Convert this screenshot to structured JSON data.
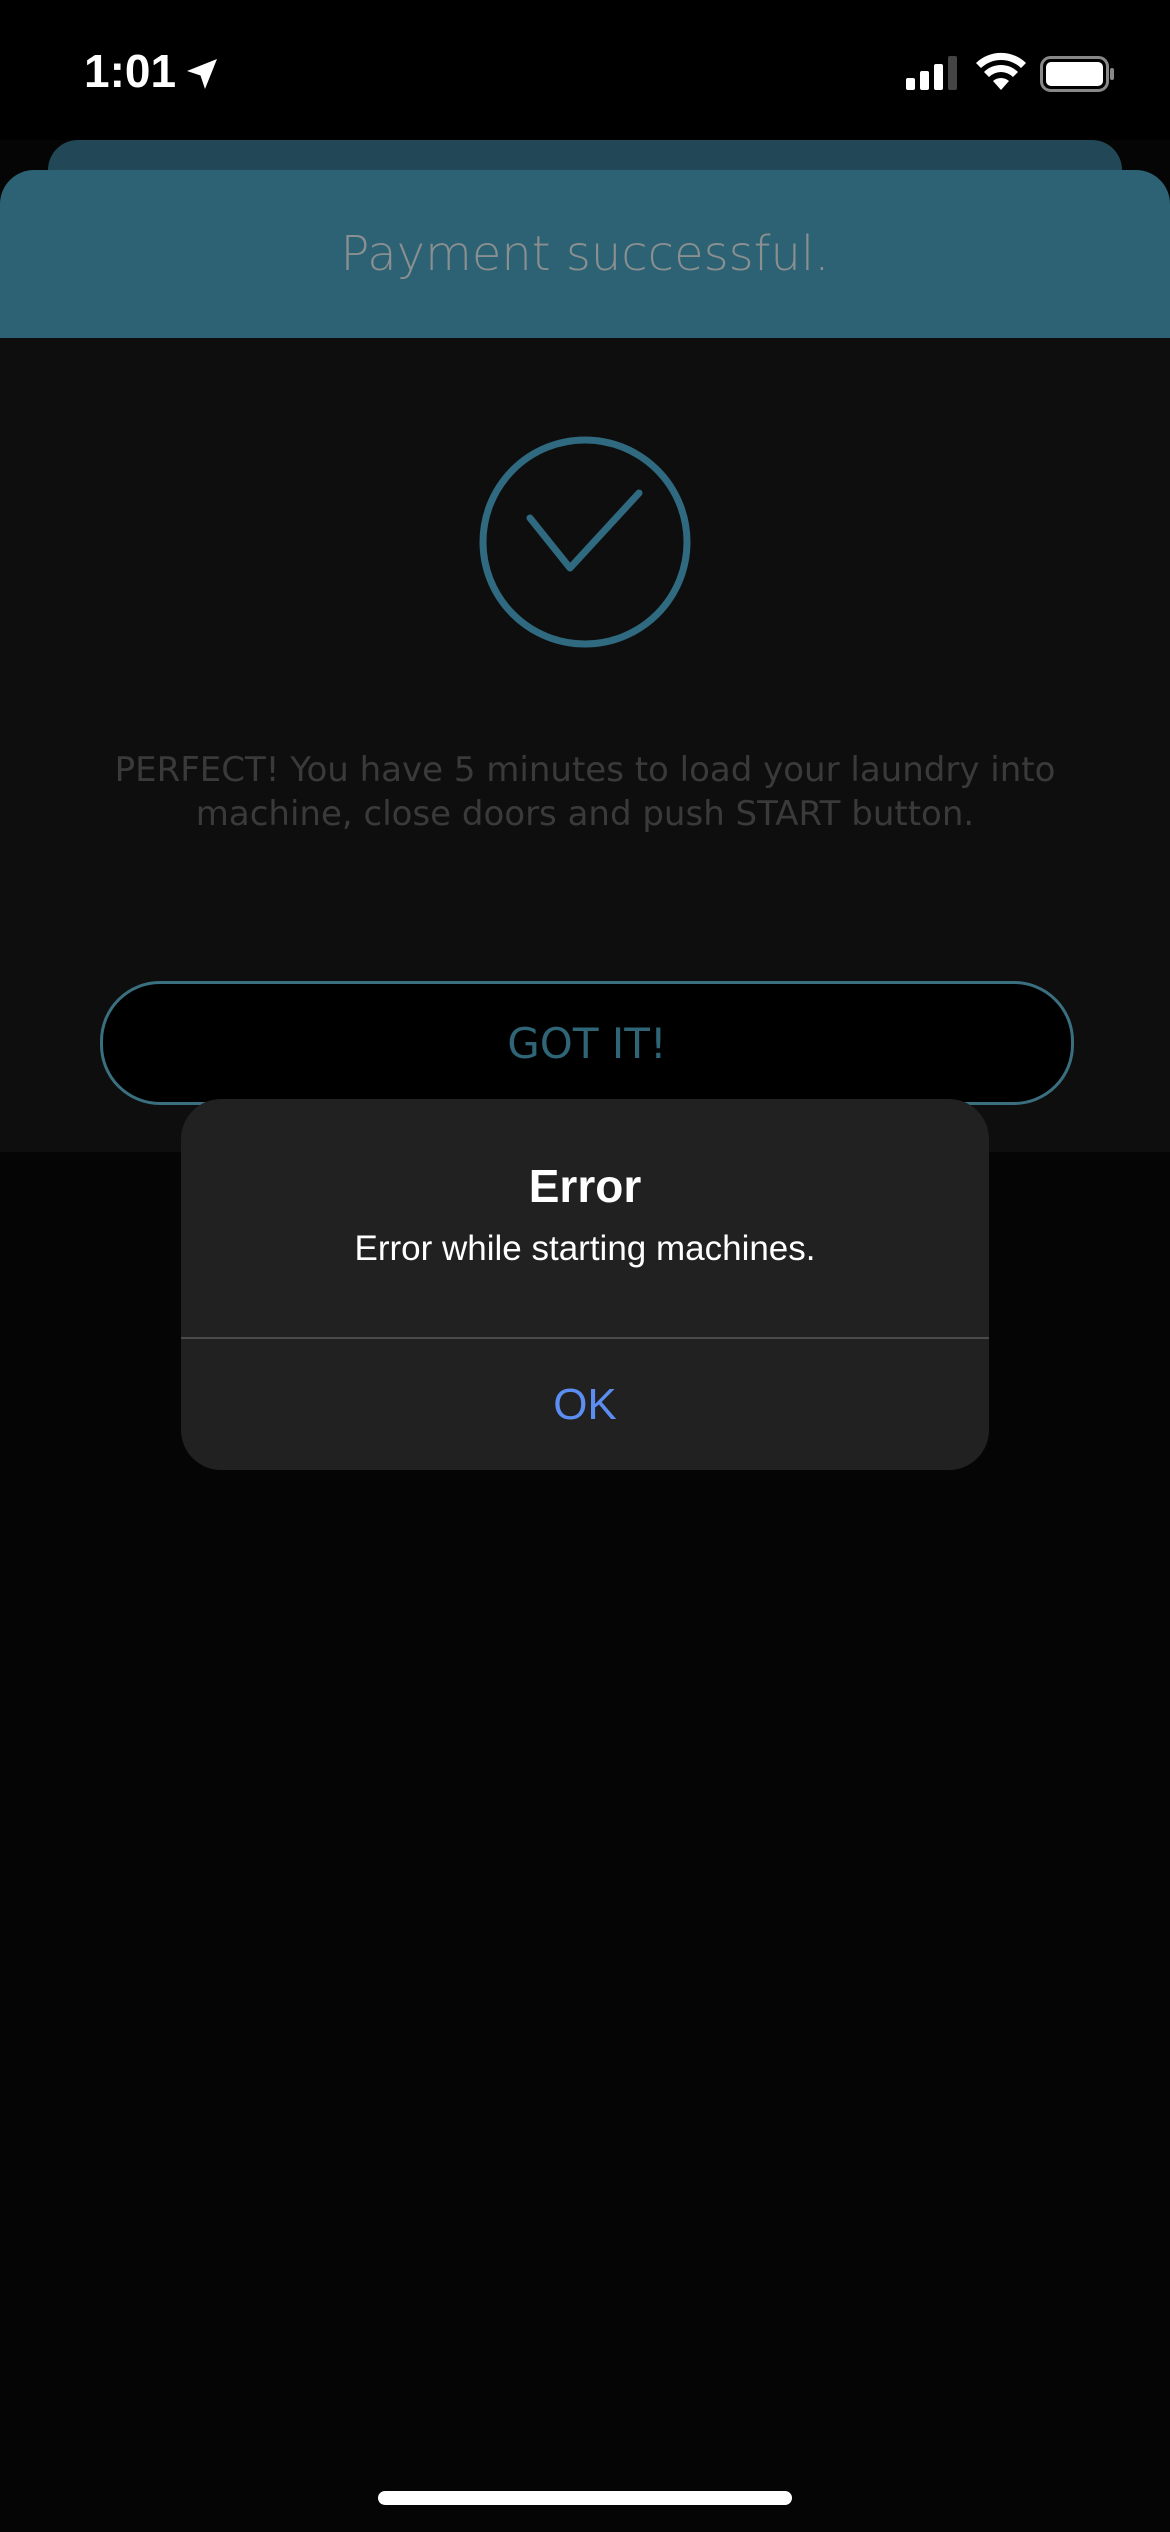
{
  "status_bar": {
    "time": "1:01",
    "icons": [
      "location-arrow-icon",
      "signal-icon",
      "wifi-icon",
      "battery-icon"
    ]
  },
  "header": {
    "title": "Payment successful."
  },
  "content": {
    "icon": "check-circle-icon",
    "message": "PERFECT! You have 5 minutes to load your laundry into machine, close doors and push START button.",
    "button_label": "GOT IT!"
  },
  "alert": {
    "title": "Error",
    "message": "Error while starting machines.",
    "ok_label": "OK"
  },
  "colors": {
    "accent": "#2c6273",
    "alert_button": "#5b8ef0"
  }
}
